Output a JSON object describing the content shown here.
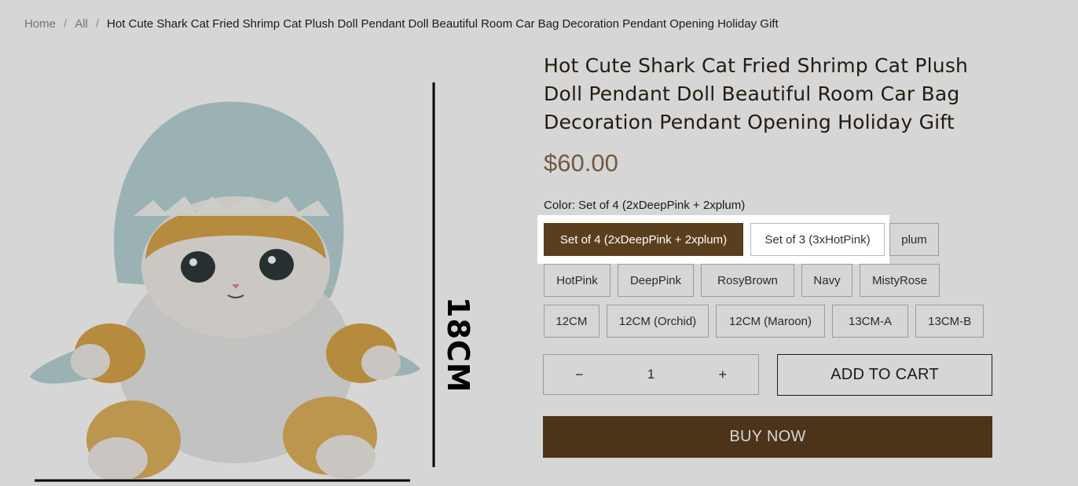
{
  "breadcrumb": {
    "home": "Home",
    "all": "All",
    "current": "Hot Cute Shark Cat Fried Shrimp Cat Plush Doll Pendant Doll Beautiful Room Car Bag Decoration Pendant Opening Holiday Gift",
    "separator": "/"
  },
  "product": {
    "title": "Hot Cute Shark Cat Fried Shrimp Cat Plush Doll Pendant Doll Beautiful Room Car Bag Decoration Pendant Opening Holiday Gift",
    "price": "$60.00",
    "image_label": "18CM"
  },
  "color": {
    "label": "Color:",
    "selected_value": "Set of 4 (2xDeepPink + 2xplum)"
  },
  "options": {
    "row1": [
      "Set of 4 (2xDeepPink + 2xplum)",
      "Set of 3 (3xHotPink)",
      "plum"
    ],
    "row2": [
      "HotPink",
      "DeepPink",
      "RosyBrown",
      "Navy",
      "MistyRose"
    ],
    "row3": [
      "12CM",
      "12CM (Orchid)",
      "12CM (Maroon)",
      "13CM-A",
      "13CM-B"
    ]
  },
  "quantity": {
    "minus": "−",
    "value": "1",
    "plus": "+"
  },
  "actions": {
    "add_to_cart": "ADD TO CART",
    "buy_now": "BUY NOW"
  },
  "colors": {
    "accent": "#5a3f1f",
    "price": "#8a6a49",
    "overlay": "rgba(0,0,0,0.16)"
  }
}
